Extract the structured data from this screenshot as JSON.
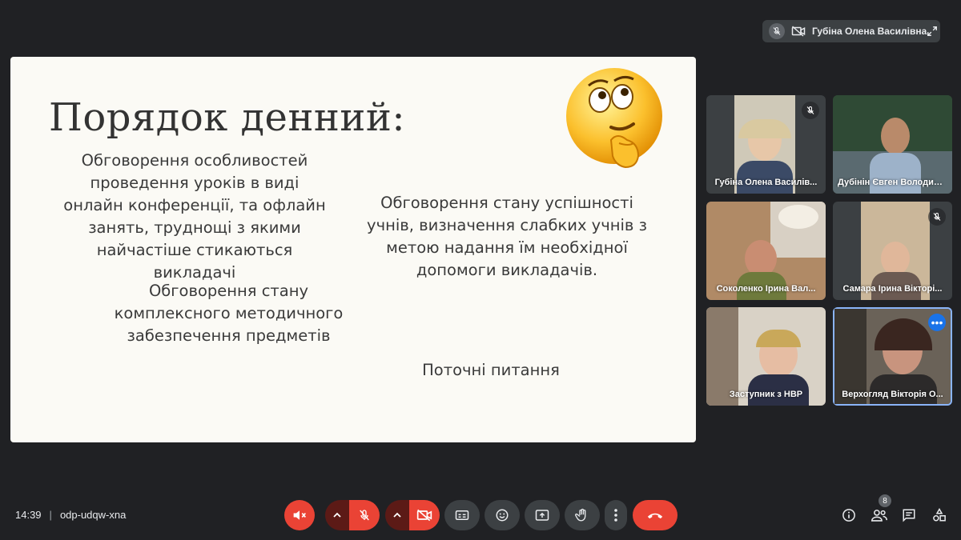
{
  "presenter": {
    "name": "Губіна Олена Василівна"
  },
  "slide": {
    "title": "Порядок денний:",
    "item1": "Обговорення особливостей проведення уроків в виді онлайн конференції, та офлайн занять, труднощі з якими найчастіше стикаються викладачі",
    "item2": "Обговорення стану комплексного методичного забезпечення предметів",
    "item3": "Обговорення стану успішності учнів, визначення слабких учнів з метою надання їм необхідної допомоги викладачів.",
    "item4": "Поточні питання"
  },
  "participants": [
    {
      "name": "Губіна Олена Василів...",
      "muted": true
    },
    {
      "name": "Дубінін Євген Володимиров...",
      "muted": false
    },
    {
      "name": "Соколенко Ірина Вал...",
      "muted": false
    },
    {
      "name": "Самара Ірина Вікторі...",
      "muted": true
    },
    {
      "name": "Заступник з НВР",
      "muted": false
    },
    {
      "name": "Верхогляд Вікторія О...",
      "muted": false,
      "active": true
    }
  ],
  "footer": {
    "time": "14:39",
    "separator": "|",
    "meeting_code": "odp-udqw-xna",
    "people_count": "8"
  },
  "colors": {
    "background": "#202124",
    "red": "#ea4335",
    "control_dark": "#3c4043",
    "accent_blue": "#1a73e8"
  }
}
